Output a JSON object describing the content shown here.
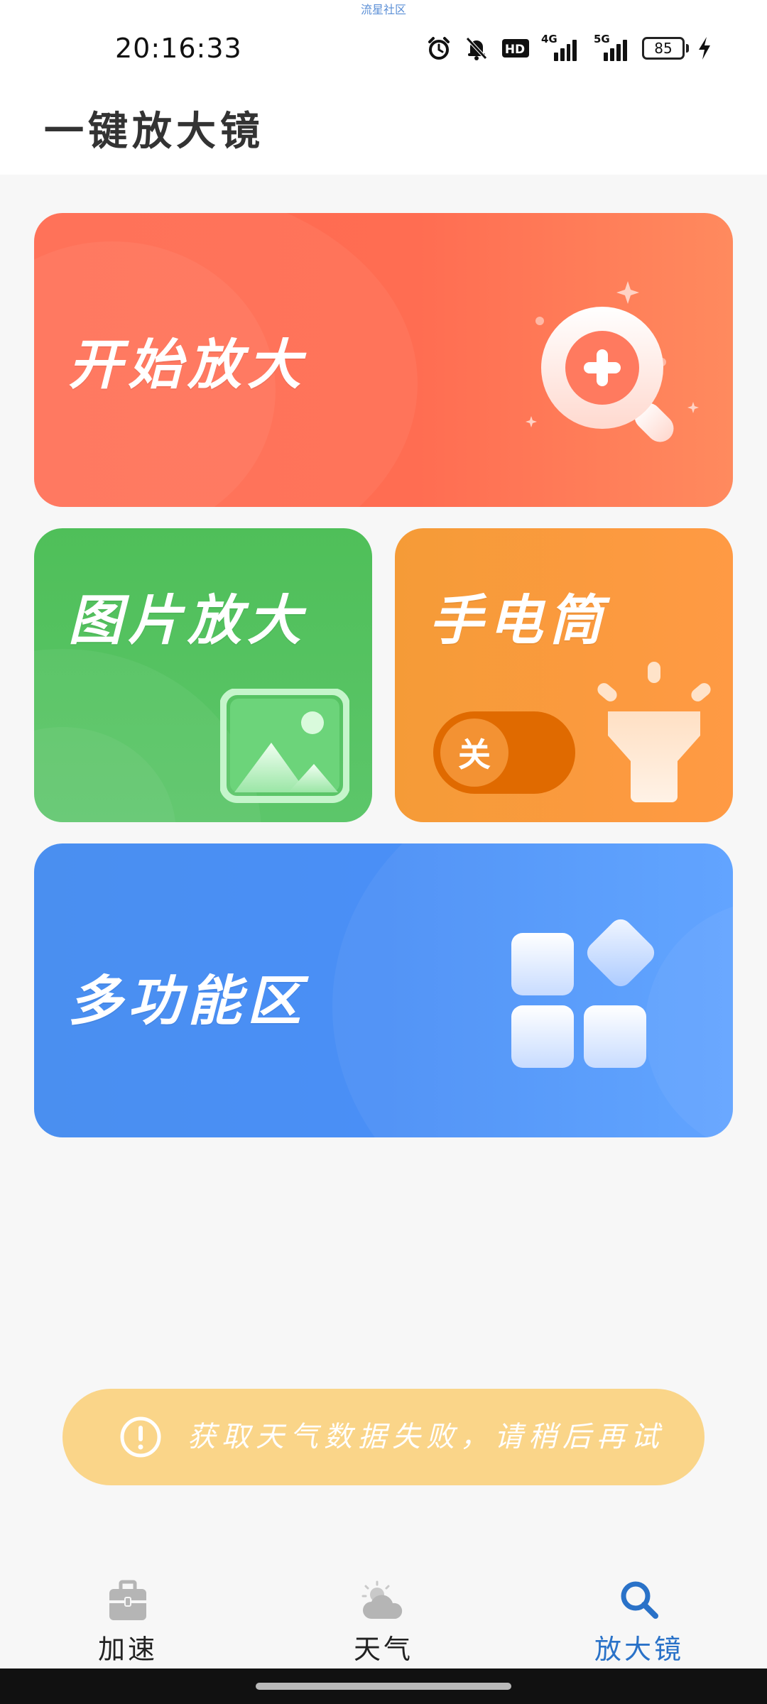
{
  "status_bar": {
    "watermark": "流星社区",
    "time": "20:16:33",
    "network1": "4G",
    "network2": "5G",
    "hd_label": "HD",
    "battery": "85"
  },
  "header": {
    "title": "一键放大镜"
  },
  "cards": {
    "start_zoom": {
      "label": "开始放大"
    },
    "image_zoom": {
      "label": "图片放大"
    },
    "flashlight": {
      "label": "手电筒",
      "toggle_label": "关"
    },
    "multi": {
      "label": "多功能区"
    }
  },
  "toast": {
    "message": "获取天气数据失败，请稍后再试"
  },
  "bottom_nav": {
    "items": [
      {
        "label": "加速",
        "icon": "toolbox-icon"
      },
      {
        "label": "天气",
        "icon": "weather-icon"
      },
      {
        "label": "放大镜",
        "icon": "search-icon"
      }
    ],
    "active_index": 2
  },
  "colors": {
    "red_card": "#ff6b51",
    "green_card": "#4fbf59",
    "orange_card": "#f7983b",
    "blue_card": "#4a8ff0",
    "toast": "#fad589",
    "active_nav": "#2a72c8"
  }
}
